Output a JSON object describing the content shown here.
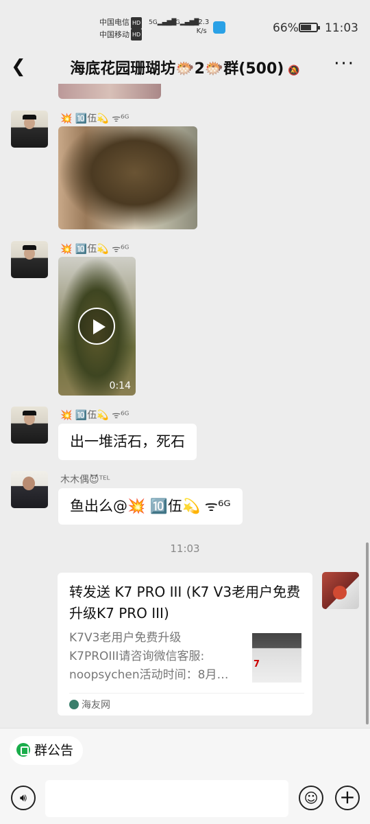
{
  "status_bar": {
    "carrier1": "中国电信",
    "carrier2": "中国移动",
    "hd": "HD",
    "sig1": "5G",
    "sig2": "4G",
    "net_speed_value": "12.3",
    "net_speed_unit": "K/s",
    "battery_pct": "66%",
    "battery_level": 0.66,
    "time": "11:03"
  },
  "header": {
    "back_icon": "chevron-left-icon",
    "title": "海底花园珊瑚坊🐡2🐡群(500)",
    "mute_icon": "bell-off-icon",
    "more_icon": "more-icon"
  },
  "messages": [
    {
      "type": "image",
      "sender": ""
    },
    {
      "type": "image",
      "sender": "💥 🔟伍💫 ᯤ⁶ᴳ"
    },
    {
      "type": "video",
      "sender": "💥 🔟伍💫 ᯤ⁶ᴳ",
      "duration": "0:14"
    },
    {
      "type": "text",
      "sender": "💥 🔟伍💫 ᯤ⁶ᴳ",
      "text": "出一堆活石，死石"
    },
    {
      "type": "text",
      "sender": "木木偶😈ᵀᴱᴸ",
      "text": "鱼出么@💥 🔟伍💫 ᯤ⁶ᴳ"
    }
  ],
  "time_separator": "11:03",
  "link_card": {
    "title": "转发送 K7 PRO III (K7 V3老用户免费升级K7 PRO III)",
    "desc_lines": [
      "K7V3老用户免费升级",
      "K7PROIII请咨询微信客服:",
      "noopsychen活动时间：8月…"
    ],
    "thumb_text": "7",
    "source": "海友网"
  },
  "bottom": {
    "announcement": "群公告",
    "voice_icon": "voice-icon",
    "emoji_icon": "emoji-icon",
    "plus_icon": "plus-icon"
  }
}
